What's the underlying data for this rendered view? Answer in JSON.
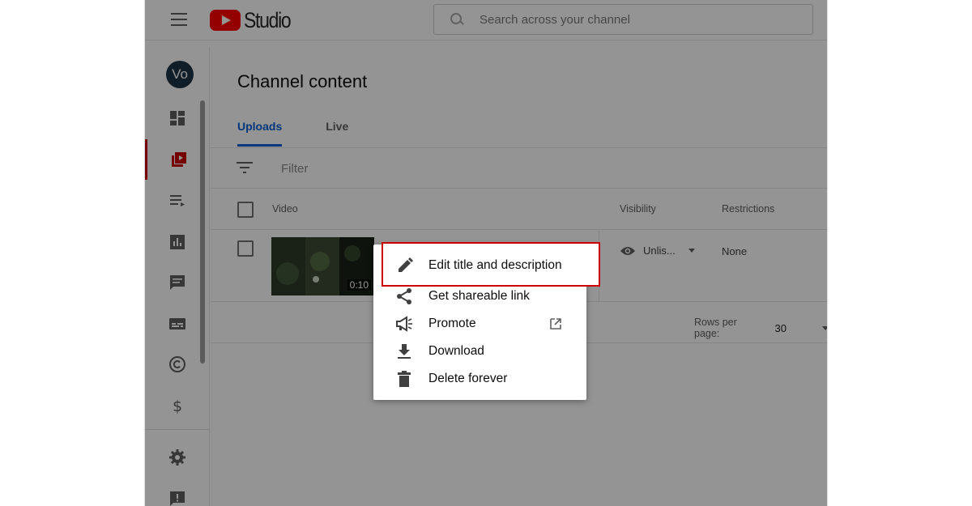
{
  "app": {
    "logo_text": "Studio",
    "search_placeholder": "Search across your channel"
  },
  "sidebar": {
    "avatar_initials": "Vo",
    "items": [
      {
        "icon": "dashboard-icon"
      },
      {
        "icon": "content-icon",
        "active": true
      },
      {
        "icon": "playlists-icon"
      },
      {
        "icon": "analytics-icon"
      },
      {
        "icon": "comments-icon"
      },
      {
        "icon": "subtitles-icon"
      },
      {
        "icon": "copyright-icon"
      },
      {
        "icon": "monetization-icon"
      },
      {
        "icon": "settings-icon"
      },
      {
        "icon": "feedback-icon"
      }
    ]
  },
  "main": {
    "page_title": "Channel content",
    "tabs": [
      {
        "label": "Uploads",
        "active": true
      },
      {
        "label": "Live",
        "active": false
      }
    ],
    "filter_placeholder": "Filter",
    "columns": {
      "video": "Video",
      "visibility": "Visibility",
      "restrictions": "Restrictions"
    },
    "row": {
      "duration": "0:10",
      "visibility": "Unlis...",
      "restrictions": "None"
    },
    "pager": {
      "label": "Rows per page:",
      "value": "30"
    }
  },
  "menu": {
    "items": [
      {
        "label": "Edit title and description",
        "icon": "pencil-icon",
        "highlighted": true
      },
      {
        "label": "Get shareable link",
        "icon": "share-icon"
      },
      {
        "label": "Promote",
        "icon": "megaphone-icon",
        "external": true
      },
      {
        "label": "Download",
        "icon": "download-icon"
      },
      {
        "label": "Delete forever",
        "icon": "trash-icon"
      }
    ]
  },
  "colors": {
    "accent_blue": "#065fd4",
    "brand_red": "#ff0000",
    "highlight_red": "#cc0000"
  }
}
